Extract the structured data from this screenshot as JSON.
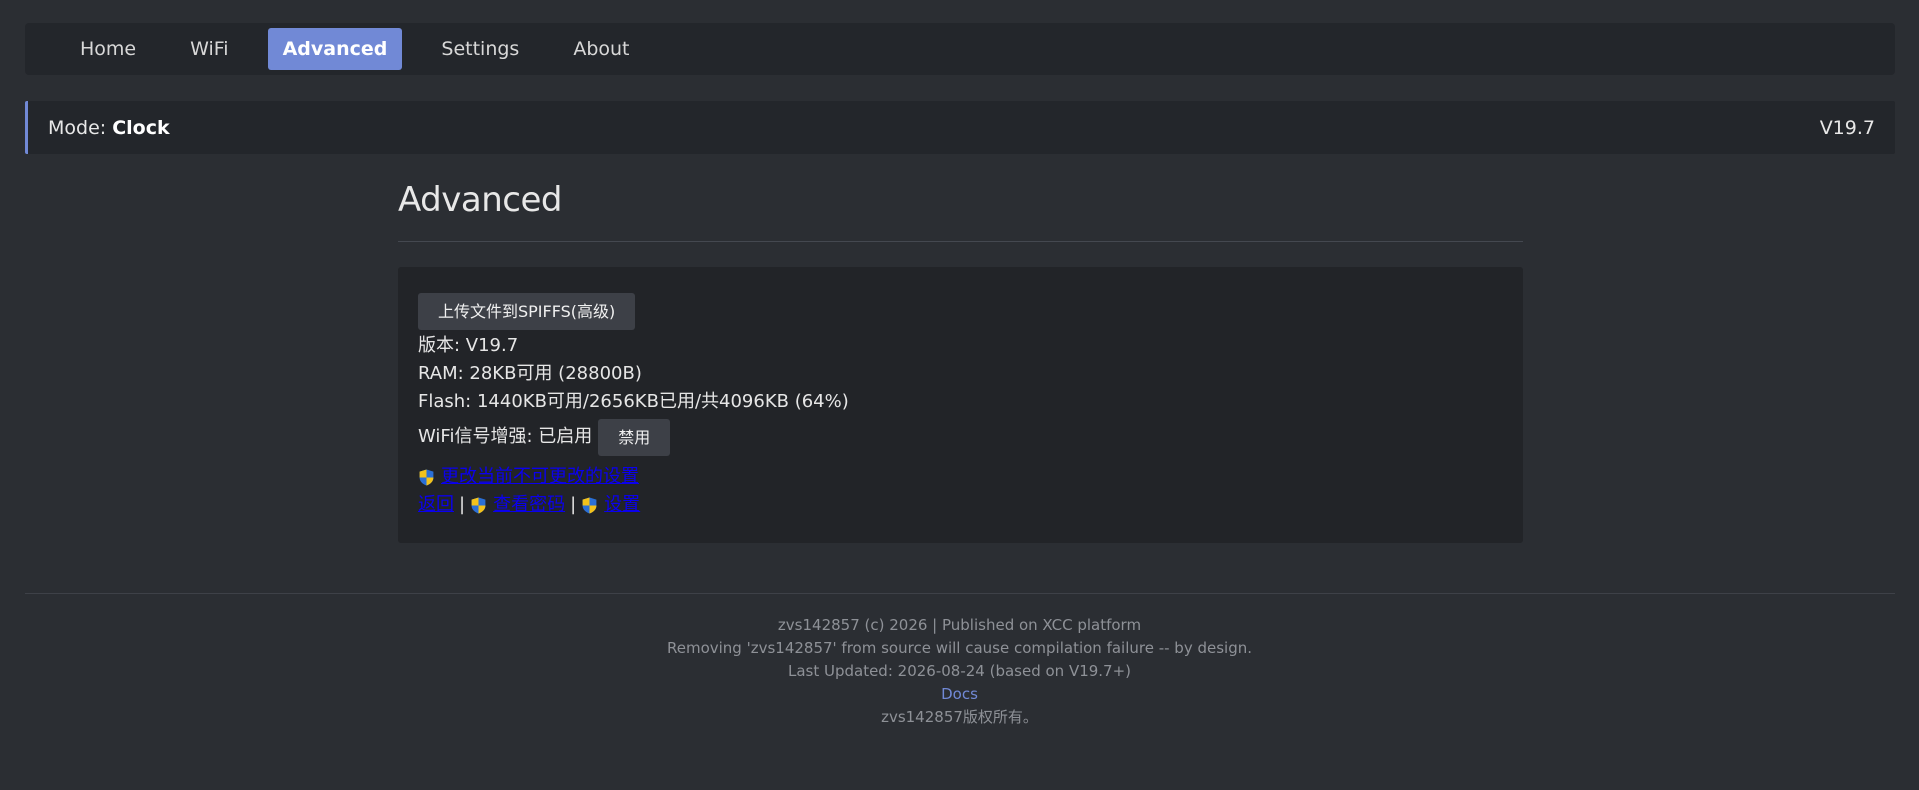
{
  "nav": {
    "items": [
      {
        "label": "Home",
        "active": false
      },
      {
        "label": "WiFi",
        "active": false
      },
      {
        "label": "Advanced",
        "active": true
      },
      {
        "label": "Settings",
        "active": false
      },
      {
        "label": "About",
        "active": false
      }
    ]
  },
  "modebar": {
    "mode_prefix": "Mode: ",
    "mode_value": "Clock",
    "version": "V19.7"
  },
  "page": {
    "title": "Advanced"
  },
  "panel": {
    "upload_button": "上传文件到SPIFFS(高级)",
    "version_line": "版本: V19.7",
    "ram_line": "RAM: 28KB可用 (28800B)",
    "flash_line": "Flash: 1440KB可用/2656KB已用/共4096KB (64%)",
    "wifi_boost_label": "WiFi信号增强: 已启用",
    "wifi_disable_button": "禁用",
    "change_locked_link": "更改当前不可更改的设置",
    "back_link": "返回",
    "separator": "|",
    "view_password_link": "查看密码",
    "settings_link": "设置"
  },
  "footer": {
    "line1": "zvs142857 (c) 2026 | Published on XCC platform",
    "line2": "Removing 'zvs142857' from source will cause compilation failure -- by design.",
    "line3": "Last Updated: 2026-08-24 (based on V19.7+)",
    "docs_link": "Docs",
    "line5": "zvs142857版权所有。"
  },
  "colors": {
    "accent": "#7189d6",
    "background": "#2b2e33",
    "panel": "#222428",
    "link": "#0b00ee"
  },
  "icons": {
    "shield": "uac-shield-icon"
  }
}
